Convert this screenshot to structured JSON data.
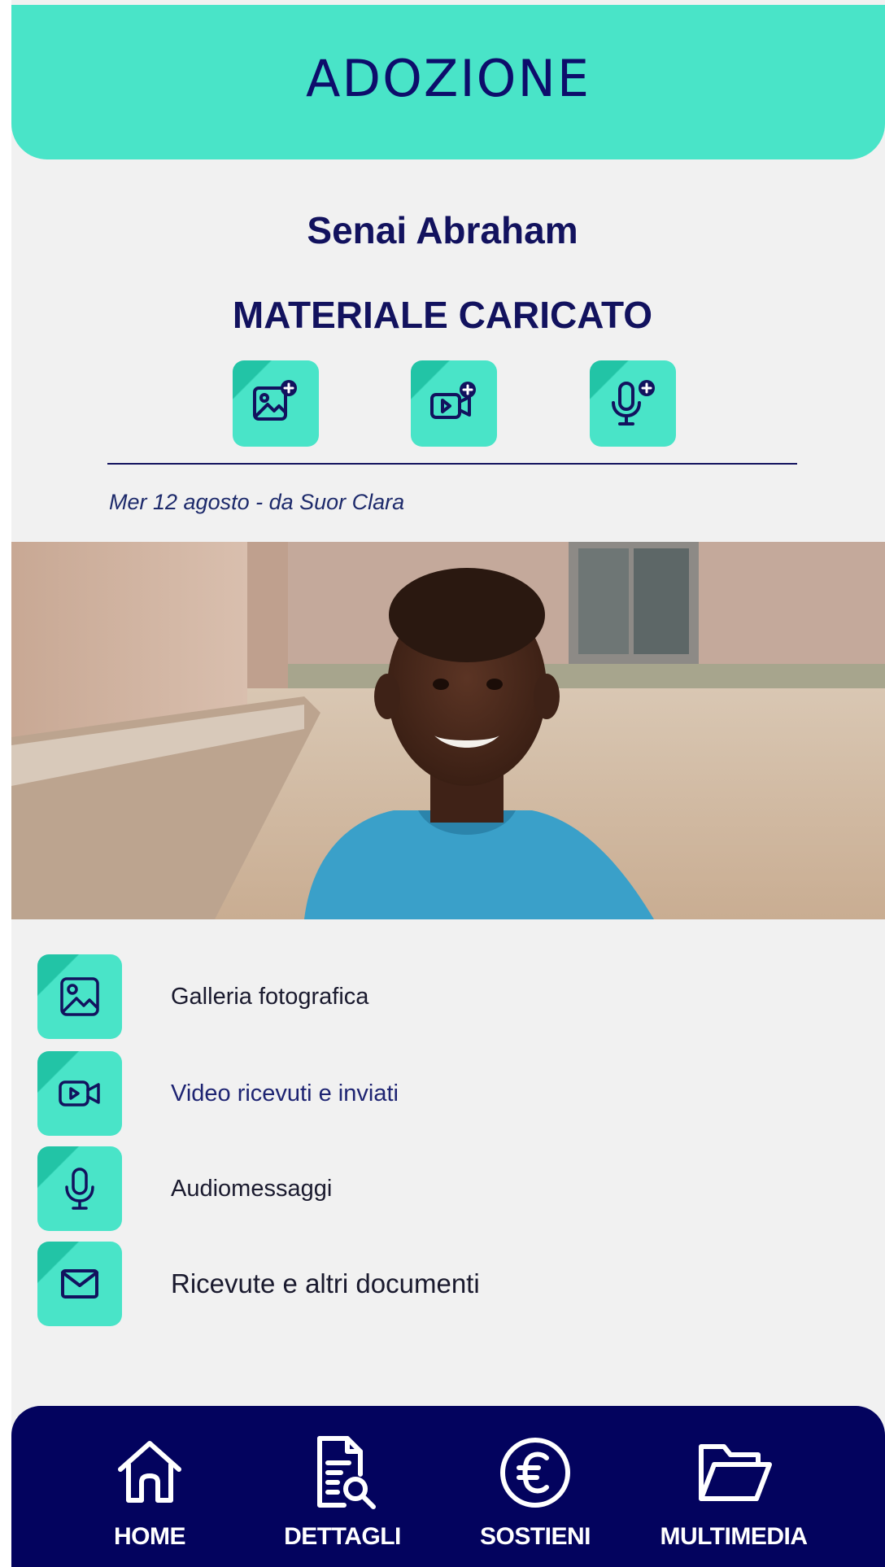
{
  "header": {
    "title": "ADOZIONE"
  },
  "child": {
    "name": "Senai Abraham"
  },
  "uploads": {
    "title": "MATERIALE CARICATO",
    "buttons": [
      {
        "icon": "add-photo-icon"
      },
      {
        "icon": "add-video-icon"
      },
      {
        "icon": "add-audio-icon"
      }
    ]
  },
  "post": {
    "meta": "Mer 12 agosto - da Suor Clara"
  },
  "menu": {
    "items": [
      {
        "label": "Galleria fotografica",
        "icon": "image-icon"
      },
      {
        "label": "Video ricevuti e inviati",
        "icon": "video-icon"
      },
      {
        "label": "Audiomessaggi",
        "icon": "microphone-icon"
      },
      {
        "label": "Ricevute e altri documenti",
        "icon": "mail-icon"
      }
    ]
  },
  "tabbar": {
    "items": [
      {
        "label": "HOME",
        "icon": "home-icon"
      },
      {
        "label": "DETTAGLI",
        "icon": "document-search-icon"
      },
      {
        "label": "SOSTIENI",
        "icon": "euro-icon"
      },
      {
        "label": "MULTIMEDIA",
        "icon": "folder-icon"
      }
    ]
  },
  "colors": {
    "accent": "#49e4c8",
    "accent_dark": "#22c4a6",
    "navy": "#03035e",
    "text": "#12125e",
    "background": "#f1f1f1"
  }
}
